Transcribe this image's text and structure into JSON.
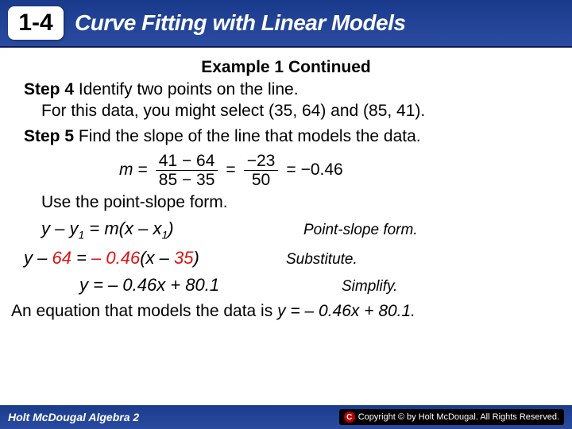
{
  "header": {
    "chapter": "1-4",
    "title": "Curve Fitting with Linear Models"
  },
  "example_title": "Example 1 Continued",
  "step4": {
    "label": "Step 4",
    "text": " Identify two points on the line.",
    "detail": "For this data, you might select (35, 64) and (85, 41)."
  },
  "step5": {
    "label": "Step 5",
    "text": " Find the slope of the line that models the data."
  },
  "slope": {
    "m": "m",
    "eq": "=",
    "num1": "41 − 64",
    "den1": "85 − 35",
    "num2": "−23",
    "den2": "50",
    "result": "−0.46"
  },
  "use_form": "Use the point-slope form.",
  "eq1": {
    "lhs_pre": "y – y",
    "lhs_sub": "1",
    "mid": "= m(x – x",
    "mid_sub": "1",
    "rhs": ")",
    "note": "Point-slope form."
  },
  "eq2": {
    "text_a": "y – ",
    "text_b": "64",
    "text_c": " = ",
    "text_d": "– 0.46",
    "text_e": "(x – ",
    "text_f": "35",
    "text_g": ")",
    "note": "Substitute."
  },
  "eq3": {
    "text": "y = – 0.46x + 80.1",
    "note": "Simplify."
  },
  "conclusion_a": "An equation that models the data is ",
  "conclusion_b": "y = – 0.46x + 80.1.",
  "footer": {
    "left": "Holt McDougal Algebra 2",
    "right": "Copyright © by Holt McDougal. All Rights Reserved."
  }
}
